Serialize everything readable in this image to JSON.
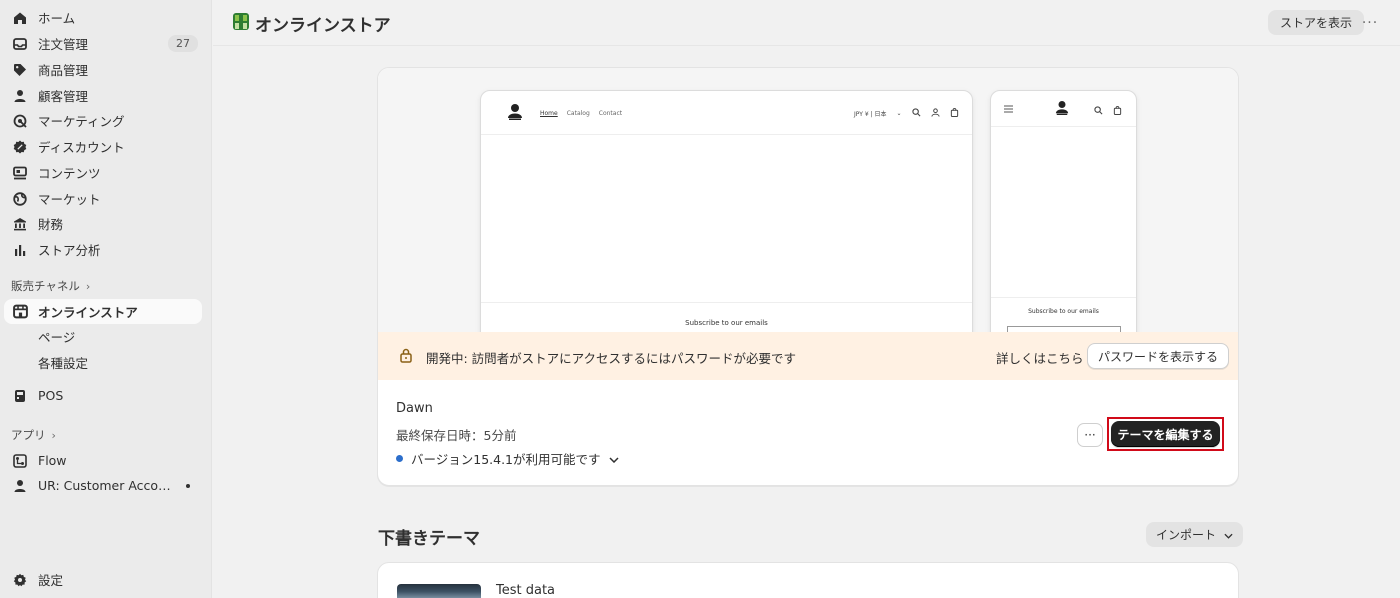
{
  "sidebar": {
    "items": [
      {
        "label": "ホーム",
        "icon": "home-icon"
      },
      {
        "label": "注文管理",
        "icon": "inbox-icon",
        "badge": "27"
      },
      {
        "label": "商品管理",
        "icon": "tag-icon"
      },
      {
        "label": "顧客管理",
        "icon": "person-icon"
      },
      {
        "label": "マーケティング",
        "icon": "target-icon"
      },
      {
        "label": "ディスカウント",
        "icon": "discount-icon"
      },
      {
        "label": "コンテンツ",
        "icon": "content-icon"
      },
      {
        "label": "マーケット",
        "icon": "globe-icon"
      },
      {
        "label": "財務",
        "icon": "bank-icon"
      },
      {
        "label": "ストア分析",
        "icon": "bar-chart-icon"
      }
    ],
    "sales_channels_label": "販売チャネル",
    "online_store_label": "オンラインストア",
    "sub_items": [
      "ページ",
      "各種設定"
    ],
    "pos_label": "POS",
    "apps_label": "アプリ",
    "apps": [
      "Flow",
      "UR: Customer Accoun..."
    ],
    "settings_label": "設定"
  },
  "topbar": {
    "title": "オンラインストア",
    "view_store_label": "ストアを表示",
    "more_label": "···"
  },
  "preview": {
    "desktop_nav": [
      "Home",
      "Catalog",
      "Contact"
    ],
    "desktop_currency": "JPY ¥ | 日本",
    "subscribe_text": "Subscribe to our emails"
  },
  "banner": {
    "message": "開発中: 訪問者がストアにアクセスするにはパスワードが必要です",
    "learn_more": "詳しくはこちら",
    "show_password_label": "パスワードを表示する"
  },
  "theme": {
    "name": "Dawn",
    "saved": "最終保存日時：5分前",
    "version": "バージョン15.4.1が利用可能です",
    "more_label": "···",
    "edit_label": "テーマを編集する"
  },
  "drafts": {
    "title": "下書きテーマ",
    "import_label": "インポート",
    "items": [
      {
        "name": "Test data"
      }
    ]
  },
  "colors": {
    "accent_blue": "#2c6ecb",
    "banner_bg": "#fff1e3",
    "highlight_red": "#d10a19"
  }
}
